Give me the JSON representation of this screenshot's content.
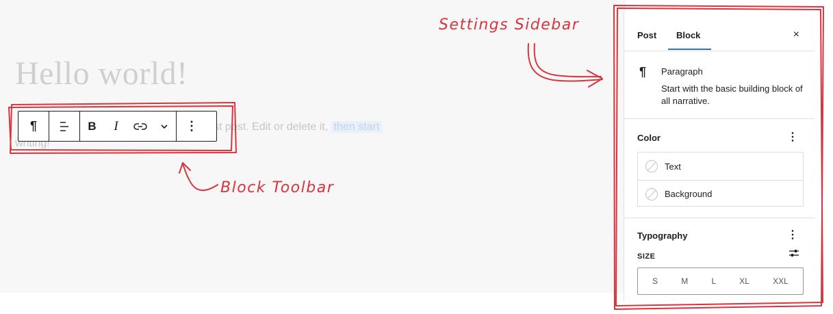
{
  "editor": {
    "title": "Hello world!",
    "text_visible_start": "writing!",
    "text_after_toolbar": "st post. Edit or delete it, ",
    "text_highlight": "then start"
  },
  "block_toolbar": {
    "buttons": [
      {
        "icon": "paragraph-icon",
        "glyph": "¶"
      },
      {
        "icon": "align-icon"
      },
      {
        "icon": "bold-icon",
        "glyph": "B"
      },
      {
        "icon": "italic-icon",
        "glyph": "I"
      },
      {
        "icon": "link-icon"
      },
      {
        "icon": "chevron-down-icon"
      },
      {
        "icon": "more-options-icon",
        "glyph": "⋮"
      }
    ]
  },
  "annotations": {
    "block_toolbar": "Block Toolbar",
    "settings_sidebar": "Settings Sidebar",
    "color": "#d9343d"
  },
  "sidebar": {
    "tabs": [
      "Post",
      "Block"
    ],
    "active_tab": "Block",
    "close_glyph": "×",
    "block_card": {
      "icon_glyph": "¶",
      "name": "Paragraph",
      "description": "Start with the basic building block of all narrative."
    },
    "color_panel": {
      "title": "Color",
      "kebab": "⋮",
      "items": [
        "Text",
        "Background"
      ]
    },
    "typography_panel": {
      "title": "Typography",
      "kebab": "⋮",
      "size_label": "SIZE",
      "sizes": [
        "S",
        "M",
        "L",
        "XL",
        "XXL"
      ]
    }
  },
  "colors": {
    "accent": "#2f6fd0",
    "annotation": "#d9343d"
  }
}
